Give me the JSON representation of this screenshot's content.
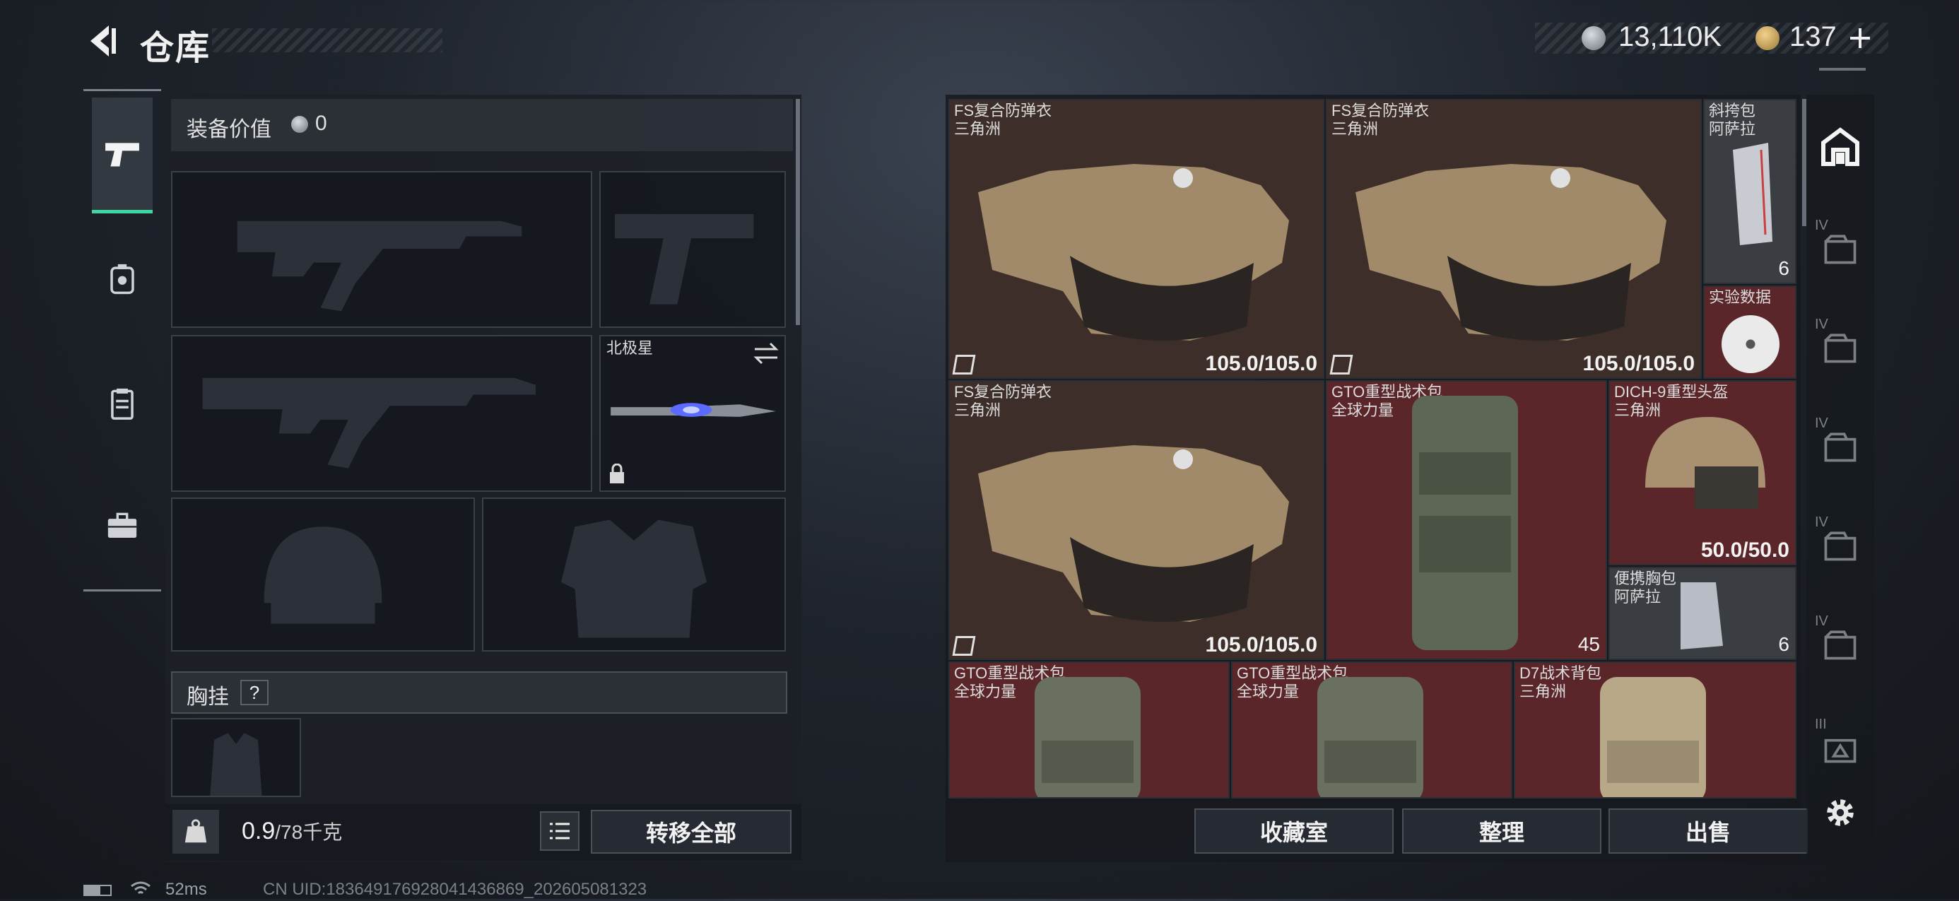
{
  "header": {
    "title": "仓库"
  },
  "currency": {
    "coins": "13,110K",
    "tickets": "137"
  },
  "equipment": {
    "value_label": "装备价值",
    "value": "0"
  },
  "knife": {
    "name": "北极星"
  },
  "chest_rig": {
    "label": "胸挂",
    "help": "?"
  },
  "footer_left": {
    "weight": "0.9",
    "capacity": "/78千克",
    "transfer_all": "转移全部"
  },
  "footer_right": {
    "collection": "收藏室",
    "sort": "整理",
    "sell": "出售"
  },
  "status_bar": {
    "ping": "52ms",
    "uid": "CN UID:183649176928041436869_202605081323"
  },
  "items": [
    {
      "name": "FS复合防弹衣",
      "brand": "三角洲",
      "durability": "105.0/105.0",
      "color": "#3d2e29"
    },
    {
      "name": "FS复合防弹衣",
      "brand": "三角洲",
      "durability": "105.0/105.0",
      "color": "#3d2e29"
    },
    {
      "name": "斜挎包",
      "brand": "阿萨拉",
      "count": "6",
      "color": "#3a3d42"
    },
    {
      "name": "实验数据",
      "color": "#5a262a"
    },
    {
      "name": "FS复合防弹衣",
      "brand": "三角洲",
      "durability": "105.0/105.0",
      "color": "#3d2e29"
    },
    {
      "name": "GTO重型战术包",
      "brand": "全球力量",
      "count": "45",
      "color": "#5a262a"
    },
    {
      "name": "DICH-9重型头盔",
      "brand": "三角洲",
      "durability": "50.0/50.0",
      "color": "#5a262a"
    },
    {
      "name": "便携胸包",
      "brand": "阿萨拉",
      "count": "6",
      "color": "#3a3d42"
    },
    {
      "name": "GTO重型战术包",
      "brand": "全球力量",
      "color": "#5a262a"
    },
    {
      "name": "GTO重型战术包",
      "brand": "全球力量",
      "color": "#5a262a"
    },
    {
      "name": "D7战术背包",
      "brand": "三角洲",
      "color": "#5a262a"
    }
  ],
  "right_rail": {
    "tiers": [
      "IV",
      "IV",
      "IV",
      "IV",
      "IV",
      "III"
    ]
  }
}
